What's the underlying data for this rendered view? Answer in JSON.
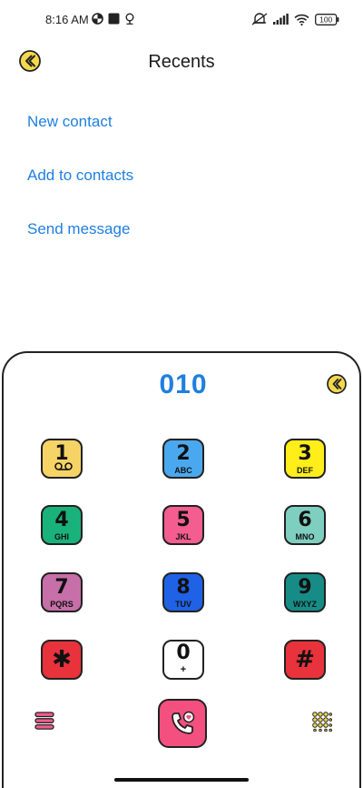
{
  "status_bar": {
    "time": "8:16 AM",
    "battery": "100",
    "icons": [
      "data-saver-icon",
      "stop-square-icon",
      "location-pin-icon",
      "mute-icon",
      "signal-icon",
      "wifi-icon",
      "battery-icon"
    ]
  },
  "header": {
    "title": "Recents",
    "back_icon": "chevron-left-circle-icon"
  },
  "actions": [
    {
      "label": "New contact"
    },
    {
      "label": "Add to contacts"
    },
    {
      "label": "Send message"
    }
  ],
  "dialer": {
    "number": "010",
    "keys": [
      {
        "digit": "1",
        "letters": "",
        "color": "#f6d365",
        "icon": "voicemail-icon"
      },
      {
        "digit": "2",
        "letters": "ABC",
        "color": "#4aa8ee"
      },
      {
        "digit": "3",
        "letters": "DEF",
        "color": "#ffee1a"
      },
      {
        "digit": "4",
        "letters": "GHI",
        "color": "#19b27a"
      },
      {
        "digit": "5",
        "letters": "JKL",
        "color": "#f45d8f"
      },
      {
        "digit": "6",
        "letters": "MNO",
        "color": "#7fcfc1"
      },
      {
        "digit": "7",
        "letters": "PQRS",
        "color": "#c66fa8"
      },
      {
        "digit": "8",
        "letters": "TUV",
        "color": "#1f62e6"
      },
      {
        "digit": "9",
        "letters": "WXYZ",
        "color": "#178c86"
      },
      {
        "digit": "✱",
        "letters": "",
        "color": "#e8323c"
      },
      {
        "digit": "0",
        "letters": "+",
        "color": "#ffffff"
      },
      {
        "digit": "#",
        "letters": "",
        "color": "#e8323c"
      }
    ],
    "call_color": "#f4507f",
    "accent": "#1f7fe0"
  }
}
